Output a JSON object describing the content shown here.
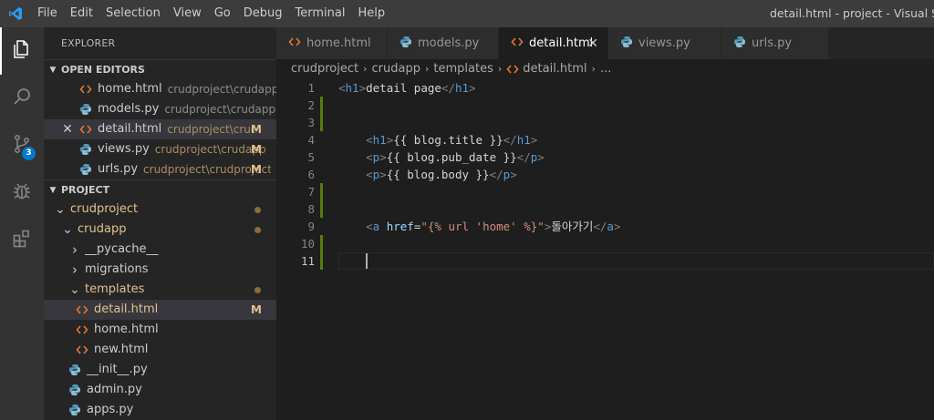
{
  "menu": [
    "File",
    "Edit",
    "Selection",
    "View",
    "Go",
    "Debug",
    "Terminal",
    "Help"
  ],
  "window_title": "detail.html - project - Visual Studio Code",
  "activity_badge": "3",
  "sidebar": {
    "title": "EXPLORER",
    "open_editors_label": "OPEN EDITORS",
    "open_editors": [
      {
        "name": "home.html",
        "path": "crudproject\\crudapp\\te...",
        "status": "",
        "icon": "html-icon"
      },
      {
        "name": "models.py",
        "path": "crudproject\\crudapp",
        "status": "",
        "icon": "python-icon"
      },
      {
        "name": "detail.html",
        "path": "crudproject\\crud...",
        "status": "M",
        "icon": "html-icon"
      },
      {
        "name": "views.py",
        "path": "crudproject\\crudapp",
        "status": "M",
        "icon": "python-icon"
      },
      {
        "name": "urls.py",
        "path": "crudproject\\crudproject",
        "status": "M",
        "icon": "python-icon"
      }
    ],
    "project_label": "PROJECT",
    "tree": [
      {
        "name": "crudproject",
        "twisty": "open"
      },
      {
        "name": "crudapp",
        "twisty": "open"
      },
      {
        "name": "__pycache__",
        "twisty": "closed"
      },
      {
        "name": "migrations",
        "twisty": "closed"
      },
      {
        "name": "templates",
        "twisty": "open"
      },
      {
        "name": "detail.html",
        "status": "M"
      },
      {
        "name": "home.html"
      },
      {
        "name": "new.html"
      },
      {
        "name": "__init__.py"
      },
      {
        "name": "admin.py"
      },
      {
        "name": "apps.py"
      }
    ]
  },
  "tabs": [
    {
      "label": "home.html",
      "icon": "html-icon"
    },
    {
      "label": "models.py",
      "icon": "python-icon"
    },
    {
      "label": "detail.html",
      "icon": "html-icon",
      "active": true
    },
    {
      "label": "views.py",
      "icon": "python-icon"
    },
    {
      "label": "urls.py",
      "icon": "python-icon"
    }
  ],
  "breadcrumb": [
    "crudproject",
    "crudapp",
    "templates",
    "detail.html",
    "..."
  ],
  "editor": {
    "line_numbers": [
      "1",
      "2",
      "3",
      "4",
      "5",
      "6",
      "7",
      "8",
      "9",
      "10",
      "11"
    ],
    "lines": [
      {
        "tokens": [
          [
            "pt",
            "<"
          ],
          [
            "tg",
            "h1"
          ],
          [
            "pt",
            ">"
          ],
          [
            "tx",
            "detail page"
          ],
          [
            "pt",
            "</"
          ],
          [
            "tg",
            "h1"
          ],
          [
            "pt",
            ">"
          ]
        ]
      },
      {
        "tokens": []
      },
      {
        "tokens": []
      },
      {
        "tokens": [
          [
            "tx",
            "    "
          ],
          [
            "pt",
            "<"
          ],
          [
            "tg",
            "h1"
          ],
          [
            "pt",
            ">"
          ],
          [
            "tx",
            "{{ blog.title }}"
          ],
          [
            "pt",
            "</"
          ],
          [
            "tg",
            "h1"
          ],
          [
            "pt",
            ">"
          ]
        ]
      },
      {
        "tokens": [
          [
            "tx",
            "    "
          ],
          [
            "pt",
            "<"
          ],
          [
            "tg",
            "p"
          ],
          [
            "pt",
            ">"
          ],
          [
            "tx",
            "{{ blog.pub_date }}"
          ],
          [
            "pt",
            "</"
          ],
          [
            "tg",
            "p"
          ],
          [
            "pt",
            ">"
          ]
        ]
      },
      {
        "tokens": [
          [
            "tx",
            "    "
          ],
          [
            "pt",
            "<"
          ],
          [
            "tg",
            "p"
          ],
          [
            "pt",
            ">"
          ],
          [
            "tx",
            "{{ blog.body }}"
          ],
          [
            "pt",
            "</"
          ],
          [
            "tg",
            "p"
          ],
          [
            "pt",
            ">"
          ]
        ]
      },
      {
        "tokens": []
      },
      {
        "tokens": []
      },
      {
        "tokens": [
          [
            "tx",
            "    "
          ],
          [
            "pt",
            "<"
          ],
          [
            "tg",
            "a"
          ],
          [
            "tx",
            " "
          ],
          [
            "at",
            "href"
          ],
          [
            "tx",
            "="
          ],
          [
            "sv",
            "\"{% url 'home' %}\""
          ],
          [
            "pt",
            ">"
          ],
          [
            "tx",
            "돌아가기"
          ],
          [
            "pt",
            "</"
          ],
          [
            "tg",
            "a"
          ],
          [
            "pt",
            ">"
          ]
        ]
      },
      {
        "tokens": []
      },
      {
        "tokens": [
          [
            "tx",
            "    "
          ]
        ]
      }
    ]
  },
  "colors": {
    "accent": "#007acc",
    "modified": "#e2c08d",
    "git_added": "#587c0c"
  }
}
